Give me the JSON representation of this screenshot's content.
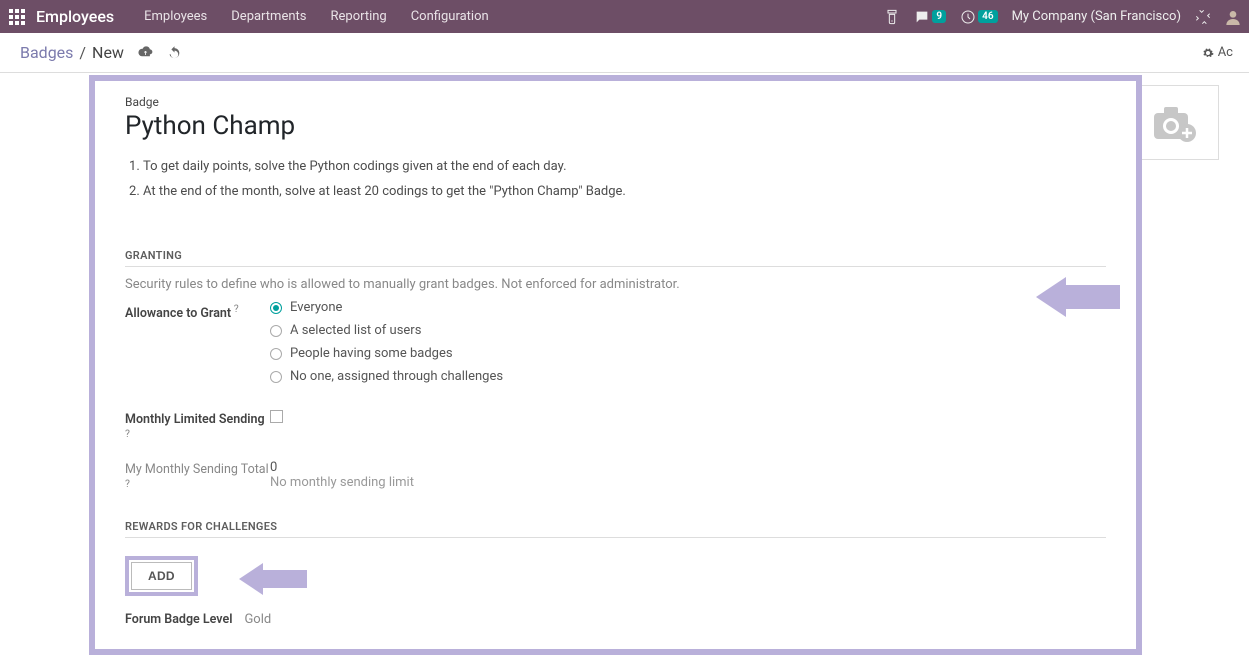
{
  "topnav": {
    "app_title": "Employees",
    "links": [
      "Employees",
      "Departments",
      "Reporting",
      "Configuration"
    ],
    "messages_count": "9",
    "activities_count": "46",
    "company": "My Company (San Francisco)"
  },
  "crumb": {
    "root": "Badges",
    "current": "New",
    "action": "Ac"
  },
  "badge": {
    "label": "Badge",
    "name": "Python Champ",
    "desc1": "To get daily points, solve the Python codings given at the end of each day.",
    "desc2": "At the end of the month, solve at least 20 codings to get the \"Python Champ\" Badge."
  },
  "granting": {
    "title": "GRANTING",
    "help": "Security rules to define who is allowed to manually grant badges. Not enforced for administrator.",
    "allowance_label": "Allowance to Grant",
    "options": {
      "everyone": "Everyone",
      "list": "A selected list of users",
      "badges": "People having some badges",
      "noone": "No one, assigned through challenges"
    },
    "monthly_limited_label": "Monthly Limited Sending",
    "monthly_total_label": "My Monthly Sending Total",
    "monthly_total_value": "0",
    "monthly_total_hint": "No monthly sending limit"
  },
  "rewards": {
    "title": "REWARDS FOR CHALLENGES",
    "add_label": "ADD",
    "forum_label": "Forum Badge Level",
    "forum_value": "Gold"
  }
}
